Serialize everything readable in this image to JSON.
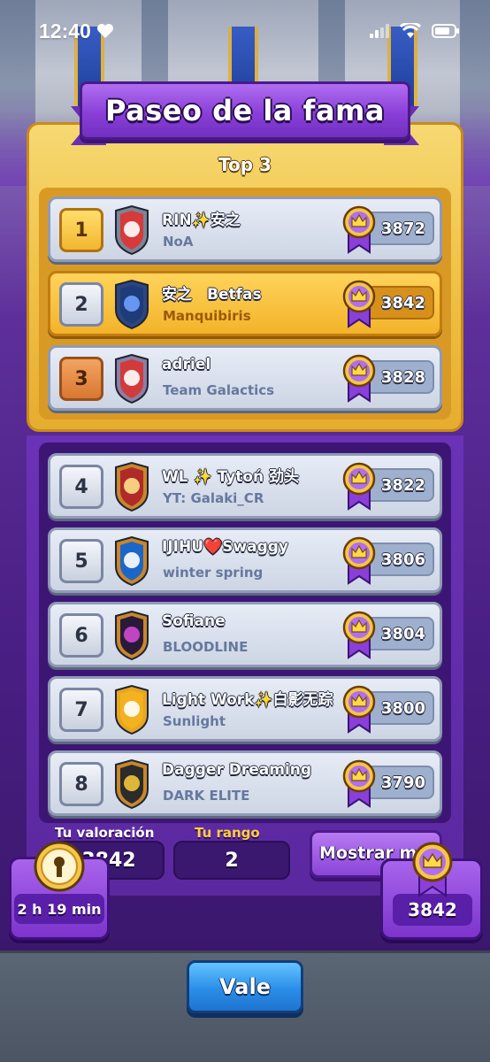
{
  "status_bar": {
    "time": "12:40"
  },
  "title": "Paseo de la fama",
  "top3_label": "Top 3",
  "colors": {
    "gold_row": "#f3b32a",
    "purple": "#6a32b6",
    "button_blue": "#2a8ee8"
  },
  "players": [
    {
      "rank": "1",
      "name": "RIN✨安之",
      "clan": "NoA",
      "trophies": "3872",
      "badge": "red-lightning-shield-icon"
    },
    {
      "rank": "2",
      "name": "安之　Betfas",
      "clan": "Manquibiris",
      "trophies": "3842",
      "badge": "blue-mountain-shield-icon"
    },
    {
      "rank": "3",
      "name": "adriel",
      "clan": "Team Galactics",
      "trophies": "3828",
      "badge": "fortress-shield-icon"
    },
    {
      "rank": "4",
      "name": "WL ✨ Tytoń 劲头",
      "clan": "YT: Galaki_CR",
      "trophies": "3822",
      "badge": "rocket-shield-icon"
    },
    {
      "rank": "5",
      "name": "IJIHU❤️Swaggy",
      "clan": "winter spring",
      "trophies": "3806",
      "badge": "snowflake-shield-icon"
    },
    {
      "rank": "6",
      "name": "Sofiane",
      "clan": "BLOODLINE",
      "trophies": "3804",
      "badge": "potion-drop-shield-icon"
    },
    {
      "rank": "7",
      "name": "Light Work✨白影无踪",
      "clan": "Sunlight",
      "trophies": "3800",
      "badge": "gold-flame-shield-icon"
    },
    {
      "rank": "8",
      "name": "Dagger Dreaming",
      "clan": "DARK ELITE",
      "trophies": "3790",
      "badge": "crown-shield-icon"
    }
  ],
  "bottom": {
    "rating_label": "Tu valoración",
    "rating_value": "3842",
    "rank_label": "Tu rango",
    "rank_value": "2",
    "show_more": "Mostrar más"
  },
  "timer": "2 h 19 min",
  "trophy_total": "3842",
  "ok_button": "Vale"
}
